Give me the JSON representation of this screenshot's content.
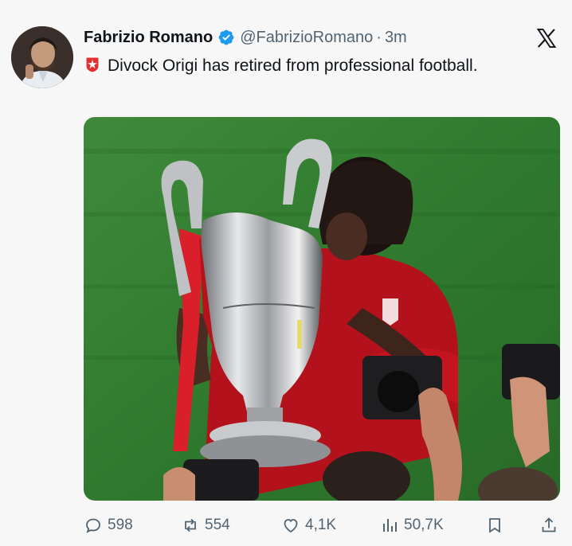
{
  "author": {
    "name": "Fabrizio Romano",
    "handle": "@FabrizioRomano",
    "time": "3m",
    "separator": "·",
    "verified": true
  },
  "tweet": {
    "badge_icon": "club-crest-icon",
    "text": "Divock Origi has retired from professional football."
  },
  "media": {
    "icon": "photo"
  },
  "stats": {
    "replies": "598",
    "reposts": "554",
    "likes": "4,1K",
    "views": "50,7K"
  },
  "icons": {
    "logo": "x-logo-icon",
    "reply": "reply-icon",
    "repost": "repost-icon",
    "like": "heart-icon",
    "views": "views-icon",
    "bookmark": "bookmark-icon",
    "share": "share-icon"
  },
  "colors": {
    "verified": "#1d9bf0",
    "text": "#0f1419",
    "secondary": "#536471",
    "background": "#f7f7f8",
    "badge_red": "#e0312f"
  }
}
